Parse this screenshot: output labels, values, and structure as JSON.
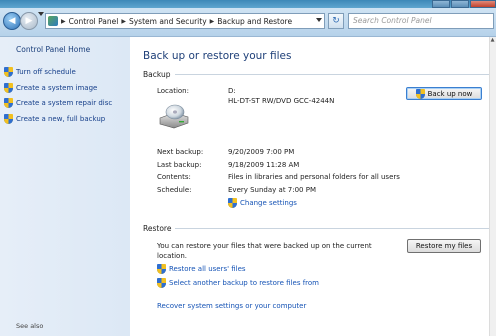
{
  "window": {
    "caption_buttons": [
      "minimize",
      "maximize",
      "close"
    ]
  },
  "nav": {
    "breadcrumb": [
      "Control Panel",
      "System and Security",
      "Backup and Restore"
    ],
    "search_placeholder": "Search Control Panel"
  },
  "sidebar": {
    "home": "Control Panel Home",
    "items": [
      {
        "label": "Turn off schedule",
        "icon": "shield-icon"
      },
      {
        "label": "Create a system image",
        "icon": "shield-icon"
      },
      {
        "label": "Create a system repair disc",
        "icon": "shield-icon"
      },
      {
        "label": "Create a new, full backup",
        "icon": "shield-icon"
      }
    ],
    "see_also": "See also"
  },
  "main": {
    "title": "Back up or restore your files",
    "backup": {
      "heading": "Backup",
      "location_label": "Location:",
      "location_drive": "D:",
      "location_device": "HL-DT-ST RW/DVD GCC-4244N",
      "backup_now": "Back up now",
      "next_label": "Next backup:",
      "next_value": "9/20/2009 7:00 PM",
      "last_label": "Last backup:",
      "last_value": "9/18/2009 11:28 AM",
      "contents_label": "Contents:",
      "contents_value": "Files in libraries and personal folders for all users",
      "schedule_label": "Schedule:",
      "schedule_value": "Every Sunday at 7:00 PM",
      "change_settings": "Change settings"
    },
    "restore": {
      "heading": "Restore",
      "description_line1": "You can restore your files that were backed up on the current",
      "description_line2": "location.",
      "restore_button": "Restore my files",
      "restore_all": "Restore all users' files",
      "select_another": "Select another backup to restore files from",
      "recover": "Recover system settings or your computer"
    }
  }
}
